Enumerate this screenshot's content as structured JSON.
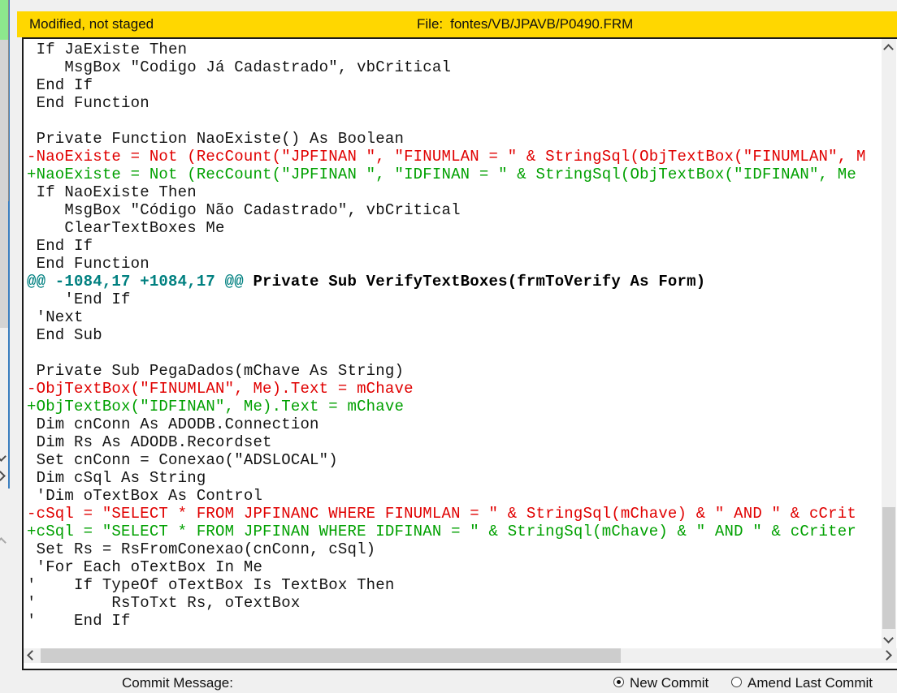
{
  "diff_header": {
    "status": "Modified, not staged",
    "file_label": "File:",
    "file_path": "fontes/VB/JPAVB/P0490.FRM"
  },
  "diff": {
    "lines": [
      {
        "type": "ctx",
        "text": " If JaExiste Then"
      },
      {
        "type": "ctx",
        "text": "    MsgBox \"Codigo Já Cadastrado\", vbCritical"
      },
      {
        "type": "ctx",
        "text": " End If"
      },
      {
        "type": "ctx",
        "text": " End Function"
      },
      {
        "type": "ctx",
        "text": ""
      },
      {
        "type": "ctx",
        "text": " Private Function NaoExiste() As Boolean"
      },
      {
        "type": "del",
        "text": "-NaoExiste = Not (RecCount(\"JPFINAN \", \"FINUMLAN = \" & StringSql(ObjTextBox(\"FINUMLAN\", M"
      },
      {
        "type": "add",
        "text": "+NaoExiste = Not (RecCount(\"JPFINAN \", \"IDFINAN = \" & StringSql(ObjTextBox(\"IDFINAN\", Me"
      },
      {
        "type": "ctx",
        "text": " If NaoExiste Then"
      },
      {
        "type": "ctx",
        "text": "    MsgBox \"Código Não Cadastrado\", vbCritical"
      },
      {
        "type": "ctx",
        "text": "    ClearTextBoxes Me"
      },
      {
        "type": "ctx",
        "text": " End If"
      },
      {
        "type": "ctx",
        "text": " End Function"
      },
      {
        "type": "hunk",
        "range": "@@ -1084,17 +1084,17 @@",
        "context": " Private Sub VerifyTextBoxes(frmToVerify As Form)"
      },
      {
        "type": "ctx",
        "text": "    'End If"
      },
      {
        "type": "ctx",
        "text": " 'Next"
      },
      {
        "type": "ctx",
        "text": " End Sub"
      },
      {
        "type": "ctx",
        "text": ""
      },
      {
        "type": "ctx",
        "text": " Private Sub PegaDados(mChave As String)"
      },
      {
        "type": "del",
        "text": "-ObjTextBox(\"FINUMLAN\", Me).Text = mChave"
      },
      {
        "type": "add",
        "text": "+ObjTextBox(\"IDFINAN\", Me).Text = mChave"
      },
      {
        "type": "ctx",
        "text": " Dim cnConn As ADODB.Connection"
      },
      {
        "type": "ctx",
        "text": " Dim Rs As ADODB.Recordset"
      },
      {
        "type": "ctx",
        "text": " Set cnConn = Conexao(\"ADSLOCAL\")"
      },
      {
        "type": "ctx",
        "text": " Dim cSql As String"
      },
      {
        "type": "ctx",
        "text": " 'Dim oTextBox As Control"
      },
      {
        "type": "del",
        "text": "-cSql = \"SELECT * FROM JPFINANC WHERE FINUMLAN = \" & StringSql(mChave) & \" AND \" & cCrit"
      },
      {
        "type": "add",
        "text": "+cSql = \"SELECT * FROM JPFINAN WHERE IDFINAN = \" & StringSql(mChave) & \" AND \" & cCriter"
      },
      {
        "type": "ctx",
        "text": " Set Rs = RsFromConexao(cnConn, cSql)"
      },
      {
        "type": "ctx",
        "text": " 'For Each oTextBox In Me"
      },
      {
        "type": "ctx",
        "text": "'    If TypeOf oTextBox Is TextBox Then"
      },
      {
        "type": "ctx",
        "text": "'        RsToTxt Rs, oTextBox"
      },
      {
        "type": "ctx",
        "text": "'    End If"
      }
    ]
  },
  "commit_area": {
    "message_label": "Commit Message:",
    "radio_new_commit": "New Commit",
    "radio_amend": "Amend Last Commit",
    "selected_radio": "new_commit"
  },
  "colors": {
    "header_bg": "#ffd700",
    "removed_text": "#e00000",
    "added_text": "#00a000",
    "hunk_header": "#008080",
    "unstaged_icon_bg": "#f99d7e",
    "staged_icon_bg": "#8de78d",
    "focus_border": "#3a7ebf"
  }
}
